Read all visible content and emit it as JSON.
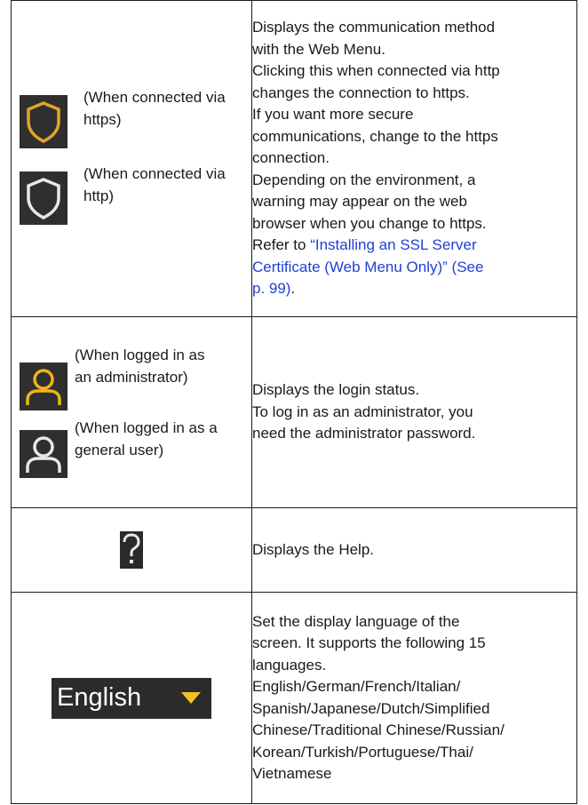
{
  "rows": [
    {
      "items": [
        {
          "icon": "shield-https-icon",
          "caption": "(When connected via https)"
        },
        {
          "icon": "shield-http-icon",
          "caption": "(When connected via http)"
        }
      ],
      "desc": [
        "Displays the communication method",
        "with the Web Menu.",
        "Clicking this when connected via http",
        "changes the connection to https.",
        "If you want more secure",
        "communications, change to the https",
        "connection.",
        "Depending on the environment, a",
        "warning may appear on the web",
        "browser when you change to https."
      ],
      "ref_prefix": "Refer to ",
      "ref_links": [
        "“Installing an SSL Server",
        "Certificate (Web Menu Only)” (See",
        "p. 99)"
      ],
      "ref_suffix": "."
    },
    {
      "items": [
        {
          "icon": "user-admin-icon",
          "caption": "(When logged in as an administrator)"
        },
        {
          "icon": "user-general-icon",
          "caption": "(When logged in as a general user)"
        }
      ],
      "desc": [
        "Displays the login status.",
        "To log in as an administrator, you",
        "need the administrator password."
      ]
    },
    {
      "icon": "help-question-icon",
      "desc": [
        "Displays the Help."
      ]
    },
    {
      "icon": "language-dropdown",
      "language_label": "English",
      "desc": [
        "Set the display language of the",
        "screen. It supports the following 15",
        "languages.",
        "English/German/French/Italian/",
        "Spanish/Japanese/Dutch/Simplified",
        "Chinese/Traditional Chinese/Russian/",
        "Korean/Turkish/Portuguese/Thai/",
        "Vietnamese"
      ]
    }
  ],
  "colors": {
    "link": "#1f3fd6",
    "shield_active": "#e0a52a",
    "shield_inactive": "#e8e8e8",
    "user_admin": "#f0b416",
    "icon_bg": "#2f2f2f"
  }
}
